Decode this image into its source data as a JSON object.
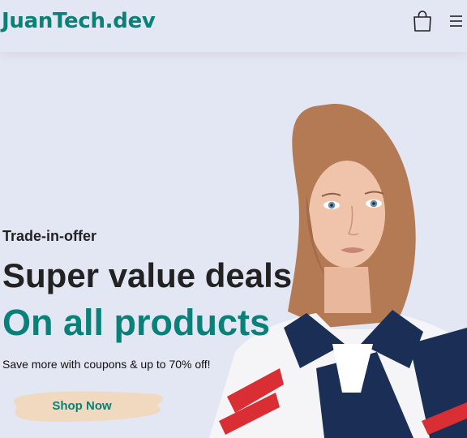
{
  "header": {
    "logo": "JuanTech.dev",
    "icons": [
      "shopping-bag-icon",
      "menu-icon"
    ]
  },
  "hero": {
    "eyebrow": "Trade-in-offer",
    "headline_line1": "Super value deals",
    "headline_line2": "On all products",
    "subtext": "Save more with coupons & up to 70% off!",
    "cta_label": "Shop Now"
  },
  "colors": {
    "brand": "#088178",
    "background": "#e3e6f3",
    "text": "#222222",
    "cta_brush": "#f0d9bf"
  }
}
